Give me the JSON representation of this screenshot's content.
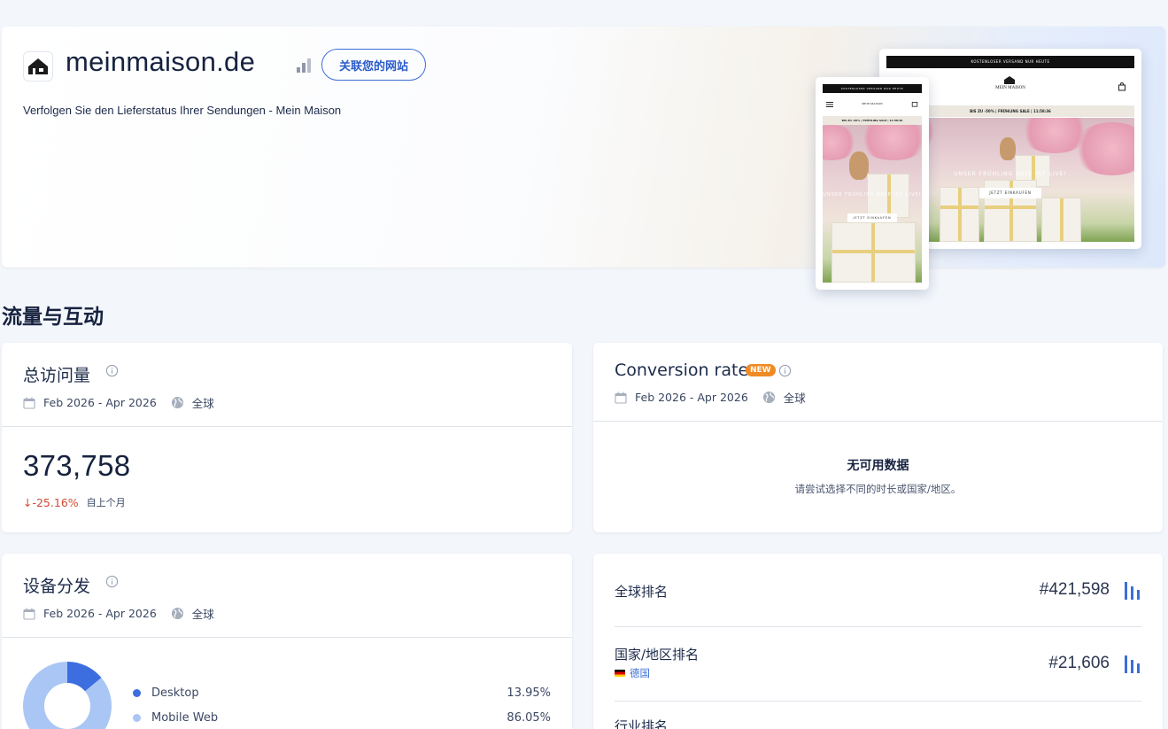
{
  "site": {
    "domain": "meinmaison.de",
    "connect_button": "关联您的网站",
    "description": "Verfolgen Sie den Lieferstatus Ihrer Sendungen - Mein Maison"
  },
  "preview": {
    "desktop_topbar": "KOSTENLOSER VERSAND NUR HEUTE",
    "desktop_brand": "MEIN MAISON",
    "desktop_sale": "BIS ZU -50% | FRÜHLING SALE | 11:58:36",
    "desktop_hero_text": "UNSER FRÜHLING SALE IST LIVE!",
    "desktop_cta": "JETZT EINKAUFEN",
    "mobile_topbar": "KOSTENLOSER VERSAND NUR HEUTE",
    "mobile_brand": "MEIN MAISON",
    "mobile_sale": "BIS ZU -50% | FRÜHLING SALE | 11:58:36",
    "mobile_hero_text": "UNSER FRÜHLING SALE IST LIVE!",
    "mobile_cta": "JETZT EINKAUFEN"
  },
  "section": {
    "title": "流量与互动"
  },
  "visits_card": {
    "title": "总访问量",
    "date_range": "Feb 2026 - Apr 2026",
    "region": "全球",
    "value": "373,758",
    "change": "↓-25.16%",
    "change_suffix": "自上个月"
  },
  "conversion_card": {
    "title": "Conversion rate",
    "badge": "NEW",
    "date_range": "Feb 2026 - Apr 2026",
    "region": "全球",
    "nodata_title": "无可用数据",
    "nodata_sub": "请尝试选择不同的时长或国家/地区。"
  },
  "device_card": {
    "title": "设备分发",
    "date_range": "Feb 2026 - Apr 2026",
    "region": "全球",
    "items": [
      {
        "label": "Desktop",
        "value": "13.95%",
        "pct": 13.95,
        "color": "#3d6ee0"
      },
      {
        "label": "Mobile Web",
        "value": "86.05%",
        "pct": 86.05,
        "color": "#a9c6f5"
      }
    ]
  },
  "ranks_card": {
    "global_label": "全球排名",
    "global_value": "#421,598",
    "country_label": "国家/地区排名",
    "country_name": "德国",
    "country_value": "#21,606",
    "industry_label": "行业排名"
  },
  "colors": {
    "accent": "#3b6fd8",
    "negative": "#d04a32",
    "badge": "#f08a24"
  }
}
